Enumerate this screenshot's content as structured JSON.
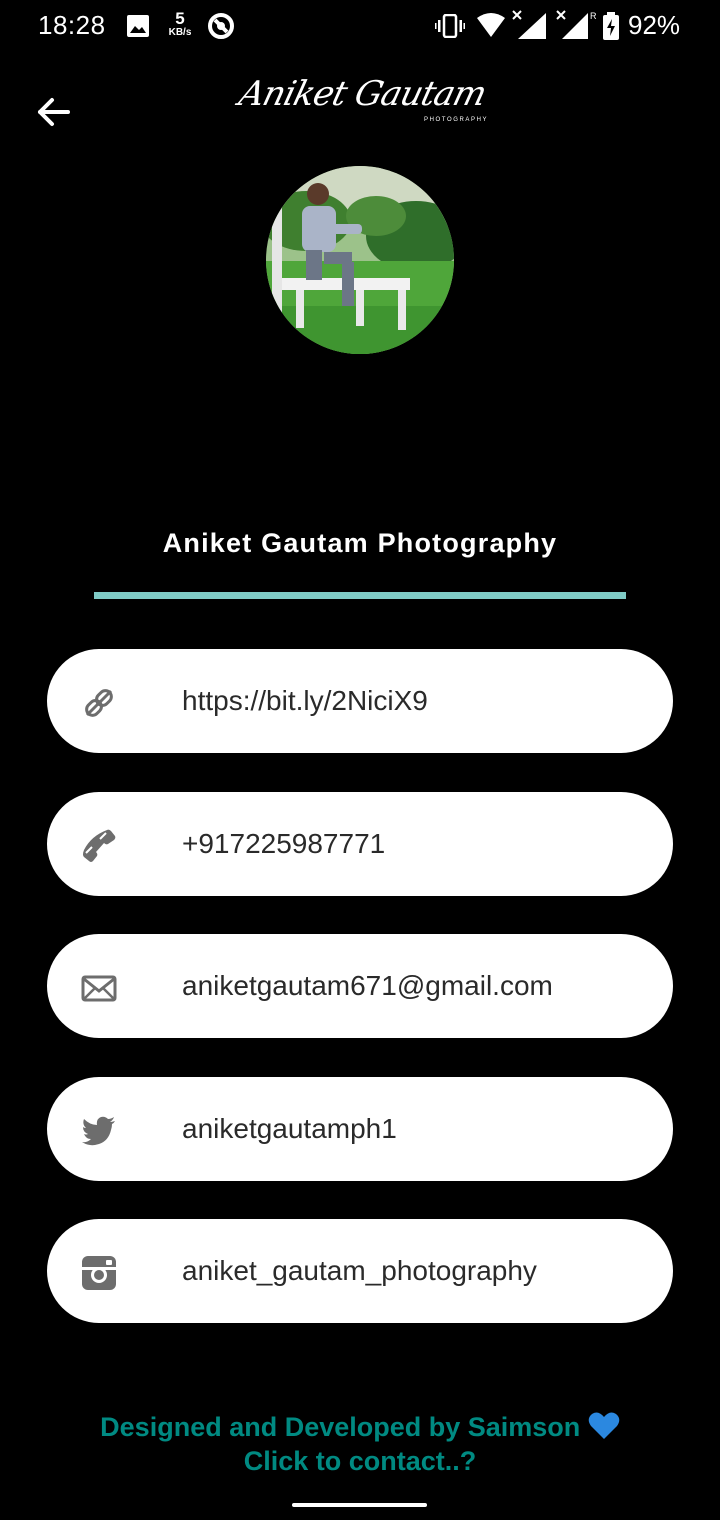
{
  "status_bar": {
    "time": "18:28",
    "net_speed_value": "5",
    "net_speed_unit": "KB/s",
    "battery_percent": "92%",
    "icons": [
      "image-icon",
      "sync-icon",
      "vibrate-icon",
      "wifi-icon",
      "signal-icon",
      "signal-roaming-icon",
      "battery-charging-icon"
    ]
  },
  "header": {
    "back_icon": "arrow-left-icon",
    "logo_script": "Aniket Gautam",
    "logo_subtitle": "PHOTOGRAPHY"
  },
  "profile": {
    "name": "Aniket Gautam Photography",
    "divider_color": "#7fcbc6"
  },
  "contacts": [
    {
      "icon": "link-icon",
      "value": "https://bit.ly/2NiciX9"
    },
    {
      "icon": "phone-icon",
      "value": "+917225987771"
    },
    {
      "icon": "email-icon",
      "value": "aniketgautam671@gmail.com"
    },
    {
      "icon": "twitter-icon",
      "value": "aniketgautamph1"
    },
    {
      "icon": "instagram-icon",
      "value": "aniket_gautam_photography"
    }
  ],
  "footer": {
    "line1": "Designed and Developed by Saimson",
    "line2": "Click to contact..?",
    "color": "#008a82"
  }
}
